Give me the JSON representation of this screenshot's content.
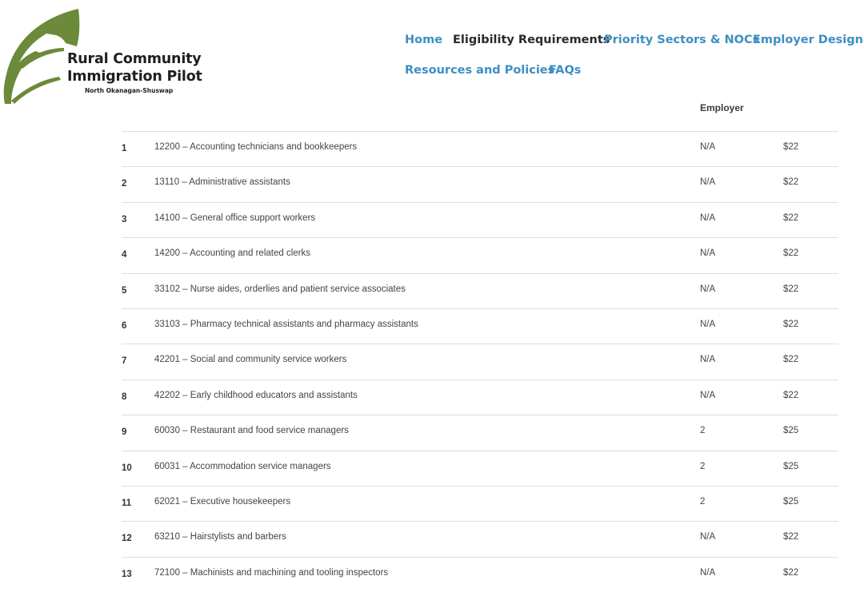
{
  "logo": {
    "line1": "Rural Community",
    "line2": "Immigration Pilot",
    "subtitle": "North Okanagan-Shuswap",
    "leaf_color": "#6b8a3a"
  },
  "nav": {
    "items": [
      {
        "label": "Home"
      },
      {
        "label": "Eligibility Requirements"
      },
      {
        "label": "Priority Sectors & NOCs"
      },
      {
        "label": "Employer Designati"
      },
      {
        "label": "Resources and Policies"
      },
      {
        "label": "FAQs"
      }
    ],
    "link_color": "#3d8fc2",
    "active_color": "#2a2a2a"
  },
  "table": {
    "header_employer": "Employer",
    "rows": [
      {
        "num": "1",
        "occupation": "12200 – Accounting technicians and bookkeepers",
        "employer": "N/A",
        "wage": "$22"
      },
      {
        "num": "2",
        "occupation": "13110 – Administrative assistants",
        "employer": "N/A",
        "wage": "$22"
      },
      {
        "num": "3",
        "occupation": "14100 – General office support workers",
        "employer": "N/A",
        "wage": "$22"
      },
      {
        "num": "4",
        "occupation": "14200 – Accounting and related clerks",
        "employer": "N/A",
        "wage": "$22"
      },
      {
        "num": "5",
        "occupation": "33102 – Nurse aides, orderlies and patient service associates",
        "employer": "N/A",
        "wage": "$22"
      },
      {
        "num": "6",
        "occupation": "33103 – Pharmacy technical assistants and pharmacy assistants",
        "employer": "N/A",
        "wage": "$22"
      },
      {
        "num": "7",
        "occupation": "42201 – Social and community service workers",
        "employer": "N/A",
        "wage": "$22"
      },
      {
        "num": "8",
        "occupation": "42202 – Early childhood educators and assistants",
        "employer": "N/A",
        "wage": "$22"
      },
      {
        "num": "9",
        "occupation": "60030 – Restaurant and food service managers",
        "employer": "2",
        "wage": "$25"
      },
      {
        "num": "10",
        "occupation": "60031 – Accommodation service managers",
        "employer": "2",
        "wage": "$25"
      },
      {
        "num": "11",
        "occupation": "62021 – Executive housekeepers",
        "employer": "2",
        "wage": "$25"
      },
      {
        "num": "12",
        "occupation": "63210 – Hairstylists and barbers",
        "employer": "N/A",
        "wage": "$22"
      },
      {
        "num": "13",
        "occupation": "72100 – Machinists and machining and tooling inspectors",
        "employer": "N/A",
        "wage": "$22"
      }
    ]
  }
}
